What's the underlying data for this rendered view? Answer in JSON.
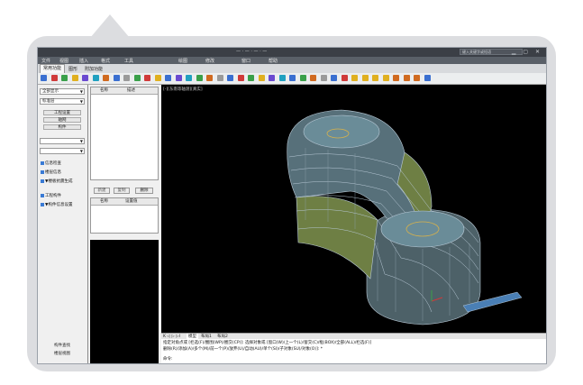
{
  "app": {
    "title": "— · — · — · —",
    "window_controls": "▁ ▢ ✕",
    "search_placeholder": "键入关键字或短语"
  },
  "menu": [
    "文件",
    "视图",
    "插入",
    "格式",
    "工具",
    "绘图",
    "修改",
    "窗口",
    "帮助"
  ],
  "ribbon_tabs": [
    {
      "label": "常用功能",
      "active": true
    },
    {
      "label": "图形",
      "active": false
    },
    {
      "label": "附加功能",
      "active": false
    }
  ],
  "toolbar": {
    "icon_colors": [
      "#3a6fd0",
      "#d03a3a",
      "#3aa04a",
      "#e0b020",
      "#6a4ad0",
      "#20a0c0",
      "#d06a20",
      "#3a6fd0",
      "#9a9a9a",
      "#3aa04a",
      "#d03a3a",
      "#e0b020",
      "#3a6fd0",
      "#6a4ad0",
      "#20a0c0",
      "#3aa04a",
      "#d06a20",
      "#9a9a9a",
      "#3a6fd0",
      "#d03a3a",
      "#3aa04a",
      "#e0b020",
      "#6a4ad0",
      "#20a0c0",
      "#3a6fd0",
      "#3aa04a",
      "#d06a20",
      "#9a9a9a",
      "#3a6fd0",
      "#d03a3a",
      "#e0b020",
      "#e0b020",
      "#e0b020",
      "#e0b020",
      "#d06a20",
      "#d06a20",
      "#d06a20",
      "#3a6fd0"
    ]
  },
  "left_panel": {
    "select1": "全部显示",
    "select2": "标准层",
    "buttons": [
      "工程设置",
      "轴网",
      "构件"
    ],
    "select3": "",
    "select4": "",
    "tree": [
      "信息检查",
      "楼层信息",
      "▼楼板抗震生成",
      "工程构件",
      "▼构件信息设置"
    ],
    "bottom": [
      "构件查找",
      "楼层视图"
    ]
  },
  "mid_panel": {
    "table1_headers": [
      "名称",
      "描述"
    ],
    "buttons": [
      "新建",
      "复制",
      "删除"
    ],
    "table2_headers": [
      "名称",
      "设置值"
    ]
  },
  "viewport": {
    "label": "[-][东南等轴测][真实]",
    "background": "#000000",
    "model_colors": {
      "floor": "#5f7f8a",
      "wall": "#8a9a4a",
      "edge": "#b8c9d6",
      "accent": "#d9b24a",
      "bridge": "#4a7fb5"
    }
  },
  "view_tabs": [
    {
      "label": "K ◁ ▷ ▷I",
      "active": false
    },
    {
      "label": "模型",
      "active": true
    },
    {
      "label": "布局1",
      "active": false
    },
    {
      "label": "布局2",
      "active": false
    }
  ],
  "command": {
    "line1": "指定对角点或 [栏选(F)/圈围(WP)/圈交(CP)]: 选择对象或 [窗口(W)/上一个(L)/窗交(C)/框(BOX)/全部(ALL)/栏选(F)]",
    "line2": "删除(R)/添加(A)/多个(M)/前一个(P)/放弃(U)/自动(AU)/单个(SI)/子对象(SU)/对象(O)]: *",
    "prompt": "命令:"
  }
}
